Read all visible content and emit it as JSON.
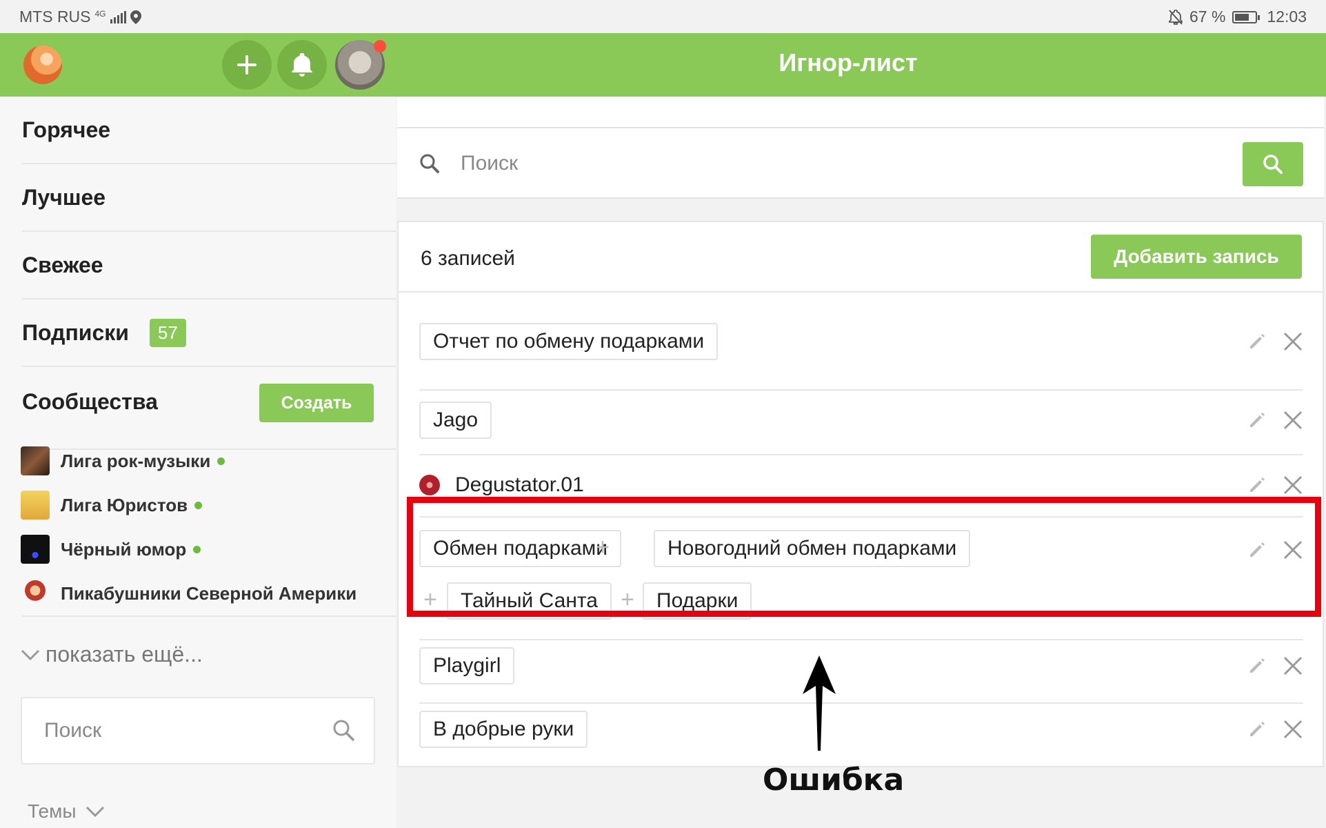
{
  "status_bar": {
    "carrier": "MTS RUS",
    "network": "4G",
    "battery": "67 %",
    "battery_level": 0.67,
    "time": "12:03"
  },
  "header": {
    "title": "Игнор-лист",
    "add_icon": "plus-icon",
    "notifications_icon": "bell-icon",
    "accent_color": "#8ac858"
  },
  "sidebar": {
    "nav": [
      {
        "label": "Горячее"
      },
      {
        "label": "Лучшее"
      },
      {
        "label": "Свежее"
      },
      {
        "label": "Подписки",
        "badge": "57"
      }
    ],
    "communities_title": "Сообщества",
    "create_label": "Создать",
    "communities": [
      {
        "name": "Лига рок-музыки",
        "online": true
      },
      {
        "name": "Лига Юристов",
        "online": true
      },
      {
        "name": "Чёрный юмор",
        "online": true
      },
      {
        "name": "Пикабушники Северной Америки",
        "online": false
      }
    ],
    "show_more": "показать ещё...",
    "search_placeholder": "Поиск",
    "themes": "Темы"
  },
  "main": {
    "search_placeholder": "Поиск",
    "count_label": "6 записей",
    "add_button": "Добавить запись",
    "entries": [
      {
        "tags": [
          "Отчет по обмену подарками"
        ]
      },
      {
        "tags": [
          "Jago"
        ]
      },
      {
        "user": "Degustator.01"
      },
      {
        "tags": [
          "Обмен подарками",
          "Новогодний обмен подарками",
          "Тайный Санта",
          "Подарки"
        ],
        "highlighted": true
      },
      {
        "tags": [
          "Playgirl"
        ]
      },
      {
        "tags": [
          "В добрые руки"
        ]
      }
    ]
  },
  "annotation": {
    "label": "Ошибка",
    "color": "#e8000f"
  }
}
